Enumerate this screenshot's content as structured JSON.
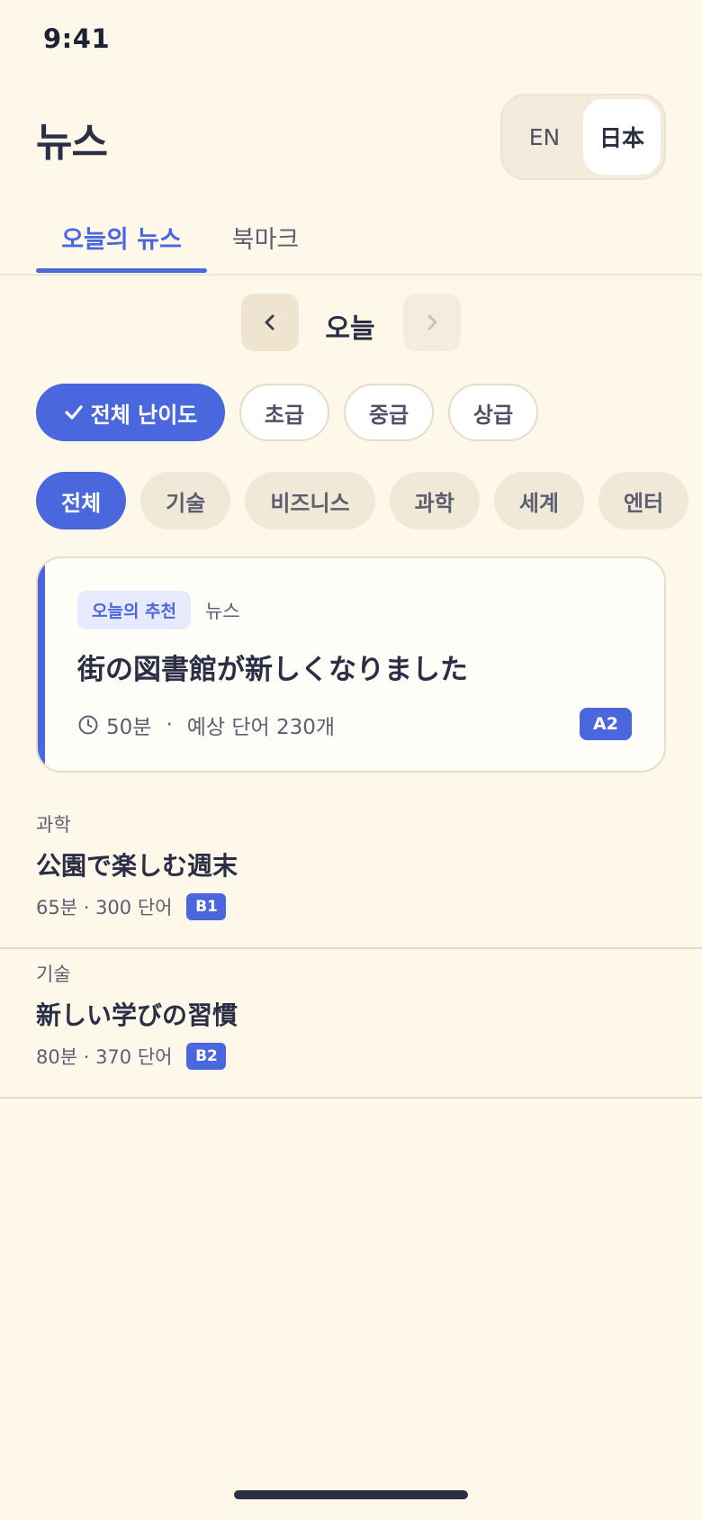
{
  "status": {
    "time": "9:41"
  },
  "header": {
    "title": "뉴스",
    "languages": [
      {
        "label": "EN",
        "active": false
      },
      {
        "label": "日本",
        "active": true
      }
    ]
  },
  "tabs": [
    {
      "label": "오늘의 뉴스",
      "active": true
    },
    {
      "label": "북마크",
      "active": false
    }
  ],
  "date_nav": {
    "label": "오늘"
  },
  "level_filters": [
    {
      "label": "전체 난이도",
      "active": true
    },
    {
      "label": "초급",
      "active": false
    },
    {
      "label": "중급",
      "active": false
    },
    {
      "label": "상급",
      "active": false
    }
  ],
  "categories": [
    {
      "label": "전체",
      "active": true
    },
    {
      "label": "기술",
      "active": false
    },
    {
      "label": "비즈니스",
      "active": false
    },
    {
      "label": "과학",
      "active": false
    },
    {
      "label": "세계",
      "active": false
    },
    {
      "label": "엔터",
      "active": false
    }
  ],
  "featured": {
    "badge": "오늘의 추천",
    "source": "뉴스",
    "title": "街の図書館が新しくなりました",
    "duration": "50분",
    "separator": "·",
    "words": "예상 단어 230개",
    "level": "A2"
  },
  "articles": [
    {
      "category": "과학",
      "title": "公園で楽しむ週末",
      "meta": "65분 · 300 단어",
      "level": "B1"
    },
    {
      "category": "기술",
      "title": "新しい学びの習慣",
      "meta": "80분 · 370 단어",
      "level": "B2"
    }
  ],
  "colors": {
    "accent": "#4B67DE",
    "background": "#FEF8EA",
    "text": "#2B2F45"
  }
}
